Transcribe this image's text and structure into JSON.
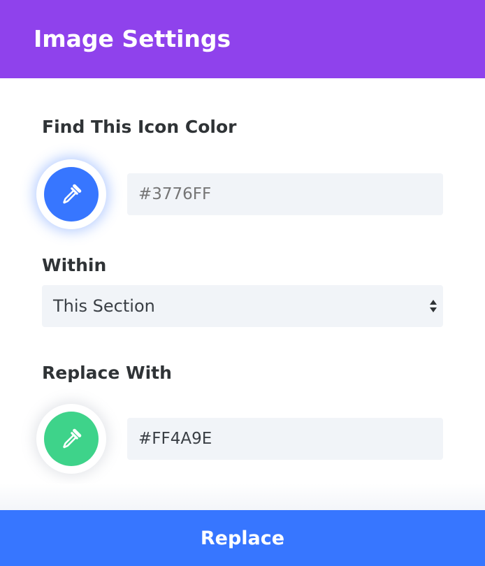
{
  "header": {
    "title": "Image Settings",
    "background": "#8f42ec"
  },
  "find_color": {
    "label": "Find This Icon Color",
    "picker_icon": "eyedropper-icon",
    "swatch_color": "#3776ff",
    "placeholder": "#3776FF",
    "value": ""
  },
  "within": {
    "label": "Within",
    "selected": "This Section",
    "arrows_icon": "sort-arrows-icon"
  },
  "replace_color": {
    "label": "Replace With",
    "picker_icon": "eyedropper-icon",
    "swatch_color": "#3ed38a",
    "placeholder": "",
    "value": "#FF4A9E"
  },
  "footer": {
    "button_label": "Replace",
    "background": "#3776ff"
  }
}
